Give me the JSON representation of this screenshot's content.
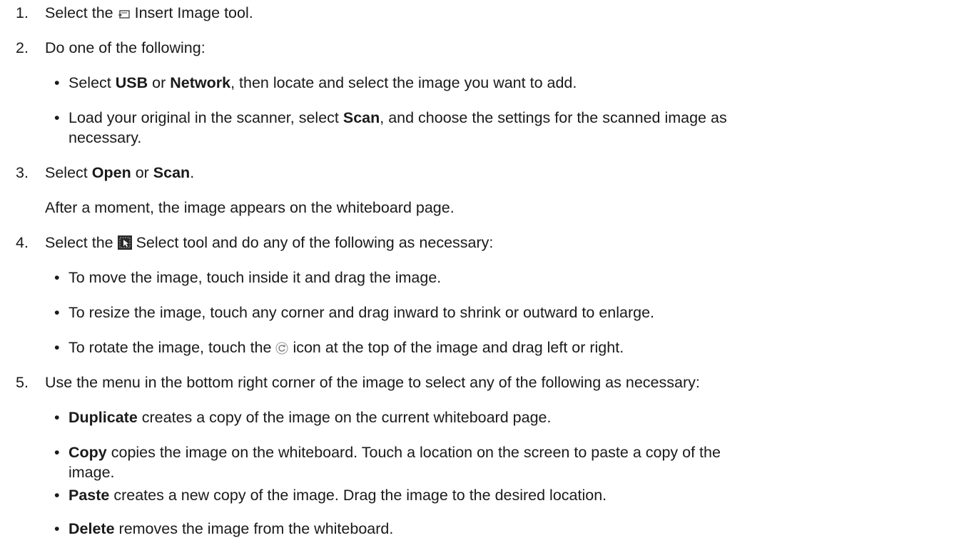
{
  "steps": [
    {
      "num": "1.",
      "pre": "Select the",
      "icon": "insert-image-icon",
      "post": "Insert Image tool."
    },
    {
      "num": "2.",
      "text": "Do one of the following:",
      "bullets": [
        {
          "b1": "Select",
          "bold1": "USB",
          "mid": "or",
          "bold2": "Network",
          "rest": ", then locate and select the image you want to add."
        },
        {
          "pre": "Load your original in the scanner, select",
          "bold": "Scan",
          "post": ", and choose the settings for the scanned image as",
          "cont": "necessary."
        }
      ]
    },
    {
      "num": "3.",
      "pre": "Select",
      "bold1": "Open",
      "mid": "or",
      "bold2": "Scan",
      "end": ".",
      "note": "After a moment, the image appears on the whiteboard page."
    },
    {
      "num": "4.",
      "pre": "Select the",
      "icon": "select-tool-icon",
      "post": "Select tool and do any of the following as necessary:",
      "bullets": [
        "To move the image, touch inside it and drag the image.",
        "To resize the image, touch any corner and drag inward to shrink or outward to enlarge.",
        {
          "pre": "To rotate the image, touch the",
          "icon": "rotate-icon",
          "post": "icon at the top of the image and drag left or right."
        }
      ]
    },
    {
      "num": "5.",
      "text": "Use the menu in the bottom right corner of the image to select any of the following as necessary:",
      "bullets": [
        {
          "bold": "Duplicate",
          "text": "creates a copy of the image on the current whiteboard page."
        },
        {
          "bold": "Copy",
          "text": "copies the image on the whiteboard. Touch a location on the screen to paste a copy of the",
          "cont": "image."
        },
        {
          "bold": "Paste",
          "text": "creates a new copy of the image. Drag the image to the desired location."
        },
        {
          "bold": "Delete",
          "text": "removes the image from the whiteboard."
        }
      ]
    }
  ],
  "bullet_char": "•"
}
